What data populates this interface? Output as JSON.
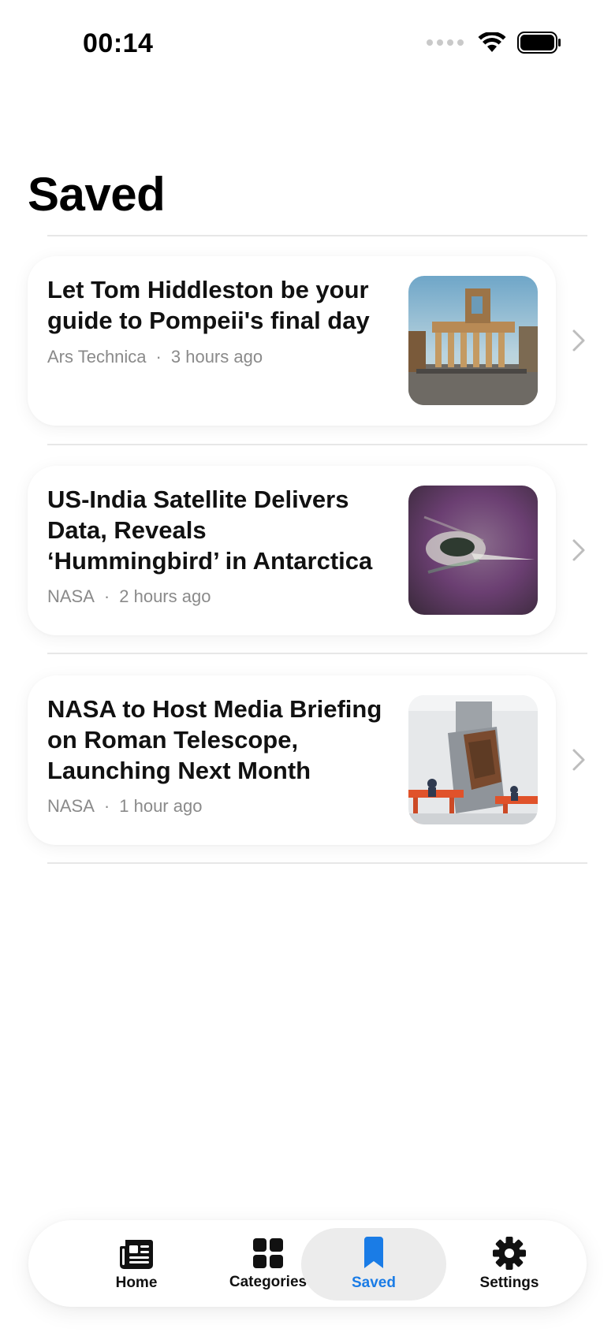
{
  "status_bar": {
    "time": "00:14"
  },
  "page": {
    "title": "Saved"
  },
  "articles": [
    {
      "title": "Let Tom Hiddleston be your guide to Pompeii's final day",
      "source": "Ars Technica",
      "separator": "·",
      "time": "3 hours ago",
      "image": "pompeii-ruins-photo"
    },
    {
      "title": "US-India Satellite Delivers Data, Reveals ‘Hummingbird’ in Antarctica",
      "source": "NASA",
      "separator": "·",
      "time": "2 hours ago",
      "image": "radar-satellite-image"
    },
    {
      "title": "NASA to Host Media Briefing on Roman Telescope, Launching Next Month",
      "source": "NASA",
      "separator": "·",
      "time": "1 hour ago",
      "image": "telescope-cleanroom-photo"
    }
  ],
  "tabbar": {
    "tabs": [
      {
        "label": "Home",
        "icon": "newspaper-icon",
        "active": false
      },
      {
        "label": "Categories",
        "icon": "grid-icon",
        "active": false
      },
      {
        "label": "Saved",
        "icon": "bookmark-icon",
        "active": true
      },
      {
        "label": "Settings",
        "icon": "gear-icon",
        "active": false
      }
    ]
  },
  "colors": {
    "accent": "#1a7ce6",
    "meta_text": "#8a8a8a",
    "active_tab_bg": "#ececec"
  }
}
